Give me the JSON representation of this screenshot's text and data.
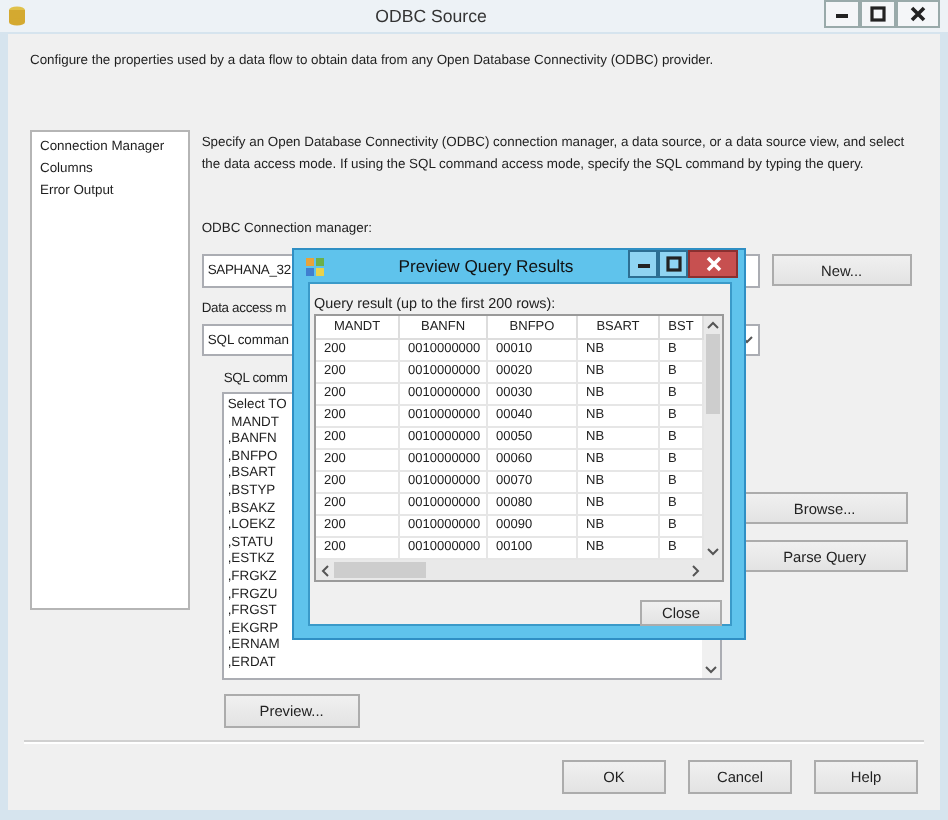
{
  "window": {
    "title": "ODBC Source"
  },
  "description": "Configure the properties used by a data flow to obtain data from any Open Database Connectivity (ODBC) provider.",
  "sidebar": {
    "items": [
      {
        "label": "Connection Manager"
      },
      {
        "label": "Columns"
      },
      {
        "label": "Error Output"
      }
    ]
  },
  "page": {
    "intro": "Specify an Open Database Connectivity (ODBC) connection manager, a data source, or a data source view, and select the data access mode. If using the SQL command access mode, specify the SQL command by typing the query.",
    "connection_label": "ODBC Connection manager:",
    "connection_value": "SAPHANA_32",
    "new_button": "New...",
    "access_label": "Data access m",
    "access_value": "SQL comman",
    "sql_label": "SQL comm",
    "sql_lines": [
      "Select TO",
      " MANDT",
      ",BANFN",
      ",BNFPO",
      ",BSART",
      ",BSTYP",
      ",BSAKZ",
      ",LOEKZ",
      ",STATU",
      ",ESTKZ",
      ",FRGKZ",
      ",FRGZU",
      ",FRGST",
      ",EKGRP",
      ",ERNAM",
      ",ERDAT"
    ],
    "browse_button": "Browse...",
    "parse_button": "Parse Query",
    "preview_button": "Preview..."
  },
  "buttons": [
    "OK",
    "Cancel",
    "Help"
  ],
  "preview": {
    "title": "Preview Query Results",
    "caption": "Query result (up to the first 200 rows):",
    "columns": [
      "MANDT",
      "BANFN",
      "BNFPO",
      "BSART",
      "BST"
    ],
    "rows": [
      [
        "200",
        "0010000000",
        "00010",
        "NB",
        "B"
      ],
      [
        "200",
        "0010000000",
        "00020",
        "NB",
        "B"
      ],
      [
        "200",
        "0010000000",
        "00030",
        "NB",
        "B"
      ],
      [
        "200",
        "0010000000",
        "00040",
        "NB",
        "B"
      ],
      [
        "200",
        "0010000000",
        "00050",
        "NB",
        "B"
      ],
      [
        "200",
        "0010000000",
        "00060",
        "NB",
        "B"
      ],
      [
        "200",
        "0010000000",
        "00070",
        "NB",
        "B"
      ],
      [
        "200",
        "0010000000",
        "00080",
        "NB",
        "B"
      ],
      [
        "200",
        "0010000000",
        "00090",
        "NB",
        "B"
      ],
      [
        "200",
        "0010000000",
        "00100",
        "NB",
        "B"
      ]
    ],
    "close_button": "Close"
  }
}
